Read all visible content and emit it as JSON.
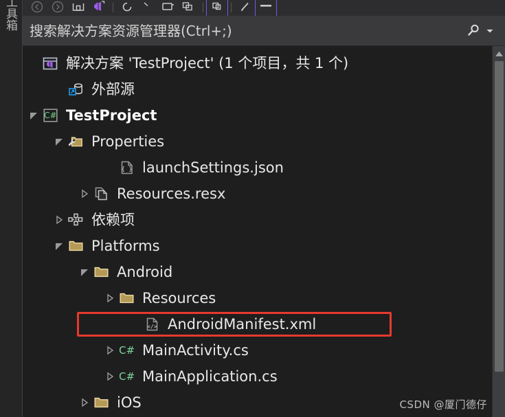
{
  "window": {
    "left_strip_label": "工具箱",
    "watermark": "CSDN @厦门德仔"
  },
  "toolbar": {
    "buttons": [
      {
        "name": "back-button",
        "icon": "circle-arrow-back-icon",
        "selected": false
      },
      {
        "name": "forward-button",
        "icon": "circle-arrow-forward-icon",
        "selected": false
      },
      {
        "name": "home-button",
        "icon": "home-icon",
        "selected": false
      },
      {
        "name": "switch-views-button",
        "icon": "visual-studio-logo-icon",
        "selected": false
      },
      {
        "name": "refresh-button",
        "icon": "refresh-icon",
        "selected": false
      },
      {
        "name": "collapse-all-button",
        "icon": "collapse-all-icon",
        "selected": false
      },
      {
        "name": "show-all-files-button",
        "icon": "show-all-files-icon",
        "selected": false
      },
      {
        "name": "preview-selected-items-button",
        "icon": "preview-file-icon",
        "selected": true
      },
      {
        "name": "properties-button",
        "icon": "wrench-pencil-icon",
        "selected": false
      },
      {
        "name": "pending-changes-filter-button",
        "icon": "filter-bar-icon",
        "selected": true
      }
    ]
  },
  "search": {
    "placeholder": "搜索解决方案资源管理器(Ctrl+;)",
    "value": "",
    "search_icon": "magnifier-icon",
    "dropdown_icon": "chevron-down-icon"
  },
  "scrollbar": {
    "up_arrow_icon": "scroll-up-arrow-icon",
    "thumb_name": "vertical-scrollbar-thumb"
  },
  "tree": {
    "highlight_color": "#e8392e",
    "rows": [
      {
        "label": "解决方案 'TestProject' (1 个项目，共 1 个)",
        "indent": 0,
        "twisty": "none",
        "icon": "solution-icon",
        "bold": false,
        "color": "#e8e8e8",
        "highlighted": false
      },
      {
        "label": "外部源",
        "indent": 1,
        "twisty": "none",
        "icon": "external-sources-icon",
        "bold": false,
        "color": "#e8e8e8",
        "highlighted": false
      },
      {
        "label": "TestProject",
        "indent": 0,
        "twisty": "expanded",
        "icon": "csharp-project-icon",
        "bold": true,
        "color": "#ffffff",
        "highlighted": false
      },
      {
        "label": "Properties",
        "indent": 1,
        "twisty": "expanded",
        "icon": "properties-folder-icon",
        "bold": false,
        "color": "#e8e8e8",
        "highlighted": false
      },
      {
        "label": "launchSettings.json",
        "indent": 3,
        "twisty": "none",
        "icon": "json-file-icon",
        "bold": false,
        "color": "#e8e8e8",
        "highlighted": false
      },
      {
        "label": "Resources.resx",
        "indent": 2,
        "twisty": "collapsed",
        "icon": "resx-file-icon",
        "bold": false,
        "color": "#e8e8e8",
        "highlighted": false
      },
      {
        "label": "依赖项",
        "indent": 1,
        "twisty": "collapsed",
        "icon": "dependencies-icon",
        "bold": false,
        "color": "#e8e8e8",
        "highlighted": false
      },
      {
        "label": "Platforms",
        "indent": 1,
        "twisty": "expanded",
        "icon": "folder-icon",
        "bold": false,
        "color": "#e8e8e8",
        "highlighted": false
      },
      {
        "label": "Android",
        "indent": 2,
        "twisty": "expanded",
        "icon": "folder-icon",
        "bold": false,
        "color": "#e8e8e8",
        "highlighted": false
      },
      {
        "label": "Resources",
        "indent": 3,
        "twisty": "collapsed",
        "icon": "folder-icon",
        "bold": false,
        "color": "#e8e8e8",
        "highlighted": false
      },
      {
        "label": "AndroidManifest.xml",
        "indent": 4,
        "twisty": "none",
        "icon": "xml-file-icon",
        "bold": false,
        "color": "#e8e8e8",
        "highlighted": true
      },
      {
        "label": "MainActivity.cs",
        "indent": 3,
        "twisty": "collapsed",
        "icon": "csharp-file-icon",
        "bold": false,
        "color": "#e8e8e8",
        "highlighted": false
      },
      {
        "label": "MainApplication.cs",
        "indent": 3,
        "twisty": "collapsed",
        "icon": "csharp-file-icon",
        "bold": false,
        "color": "#e8e8e8",
        "highlighted": false
      },
      {
        "label": "iOS",
        "indent": 2,
        "twisty": "collapsed",
        "icon": "folder-icon",
        "bold": false,
        "color": "#e8e8e8",
        "highlighted": false
      }
    ]
  }
}
